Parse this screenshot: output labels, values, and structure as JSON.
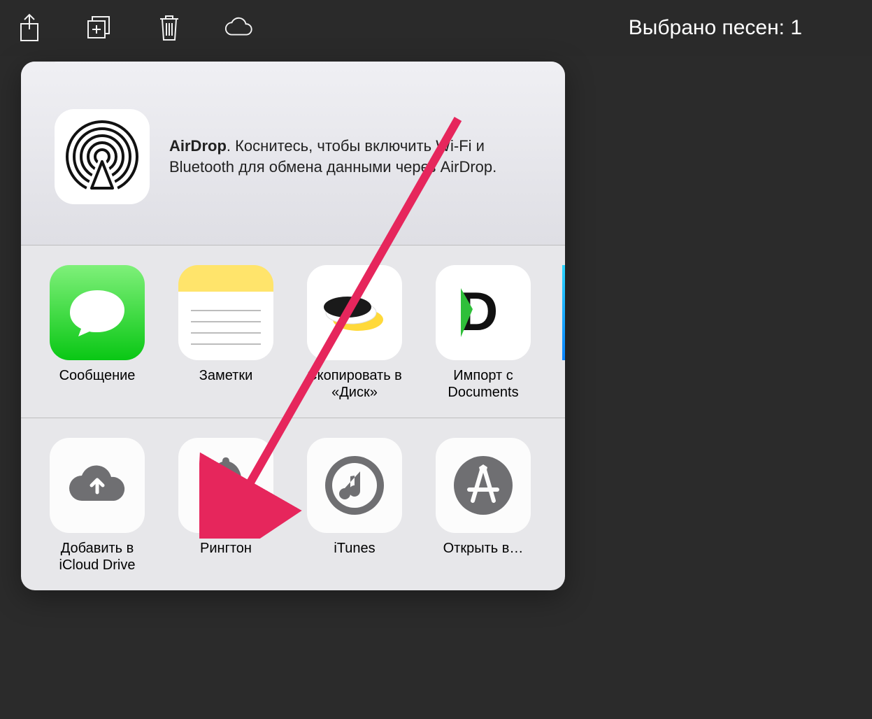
{
  "toolbar": {
    "title": "Выбрано песен: 1"
  },
  "airdrop": {
    "title": "AirDrop",
    "body": ". Коснитесь, чтобы включить Wi-Fi и Bluetooth для обмена данными через AirDrop."
  },
  "share_row": [
    {
      "label": "Сообщение"
    },
    {
      "label": "Заметки"
    },
    {
      "label": "Скопировать в «Диск»"
    },
    {
      "label": "Импорт с Documents"
    }
  ],
  "action_row": [
    {
      "label": "Добавить в iCloud Drive"
    },
    {
      "label": "Рингтон"
    },
    {
      "label": "iTunes"
    },
    {
      "label": "Открыть в…"
    }
  ]
}
